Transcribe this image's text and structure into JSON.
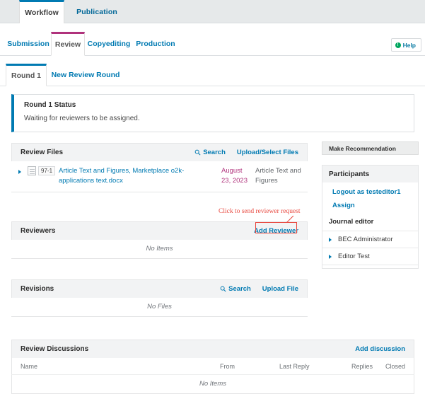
{
  "outer_tabs": [
    {
      "label": "Workflow",
      "active": true
    },
    {
      "label": "Publication",
      "active": false
    }
  ],
  "stage_tabs": [
    {
      "label": "Submission",
      "active": false
    },
    {
      "label": "Review",
      "active": true
    },
    {
      "label": "Copyediting",
      "active": false
    },
    {
      "label": "Production",
      "active": false
    }
  ],
  "help": {
    "label": "Help",
    "icon": "help-circle-icon",
    "glyph": "!"
  },
  "round_tabs": [
    {
      "label": "Round 1",
      "active": true
    },
    {
      "label": "New Review Round",
      "active": false
    }
  ],
  "status": {
    "title": "Round 1 Status",
    "text": "Waiting for reviewers to be assigned."
  },
  "review_files": {
    "title": "Review Files",
    "search_label": "Search",
    "search_icon": "search-icon",
    "upload_label": "Upload/Select Files",
    "rows": [
      {
        "expander_icon": "triangle-right-icon",
        "doc_icon": "document-icon",
        "badge": "97-1",
        "name": "Article Text and Figures, Marketplace o2k-applications text.docx",
        "date": "August 23, 2023",
        "genre": "Article Text and Figures"
      }
    ]
  },
  "reviewers": {
    "title": "Reviewers",
    "add_label": "Add Reviewer",
    "empty": "No Items"
  },
  "revisions": {
    "title": "Revisions",
    "search_label": "Search",
    "search_icon": "search-icon",
    "upload_label": "Upload File",
    "empty": "No Files"
  },
  "discussions": {
    "title": "Review Discussions",
    "add_label": "Add discussion",
    "columns": [
      "Name",
      "From",
      "Last Reply",
      "Replies",
      "Closed"
    ],
    "empty": "No Items"
  },
  "sidebar": {
    "recommend_label": "Make Recommendation",
    "participants": {
      "title": "Participants",
      "logout_label": "Logout as testeditor1",
      "assign_label": "Assign",
      "group_label": "Journal editor",
      "members": [
        {
          "name": "BEC Administrator",
          "icon": "triangle-right-icon"
        },
        {
          "name": "Editor Test",
          "icon": "triangle-right-icon"
        }
      ]
    }
  },
  "annotation": {
    "text": "Click to send reviewer request",
    "color": "#e8483f",
    "target": "Add Reviewer"
  },
  "colors": {
    "link": "#007ab2",
    "active_stage_border": "#b0327c",
    "active_tab_border": "#007ab2",
    "date": "#b0327c",
    "annotation": "#e8483f",
    "panel_head_bg": "#f2f3f4"
  }
}
